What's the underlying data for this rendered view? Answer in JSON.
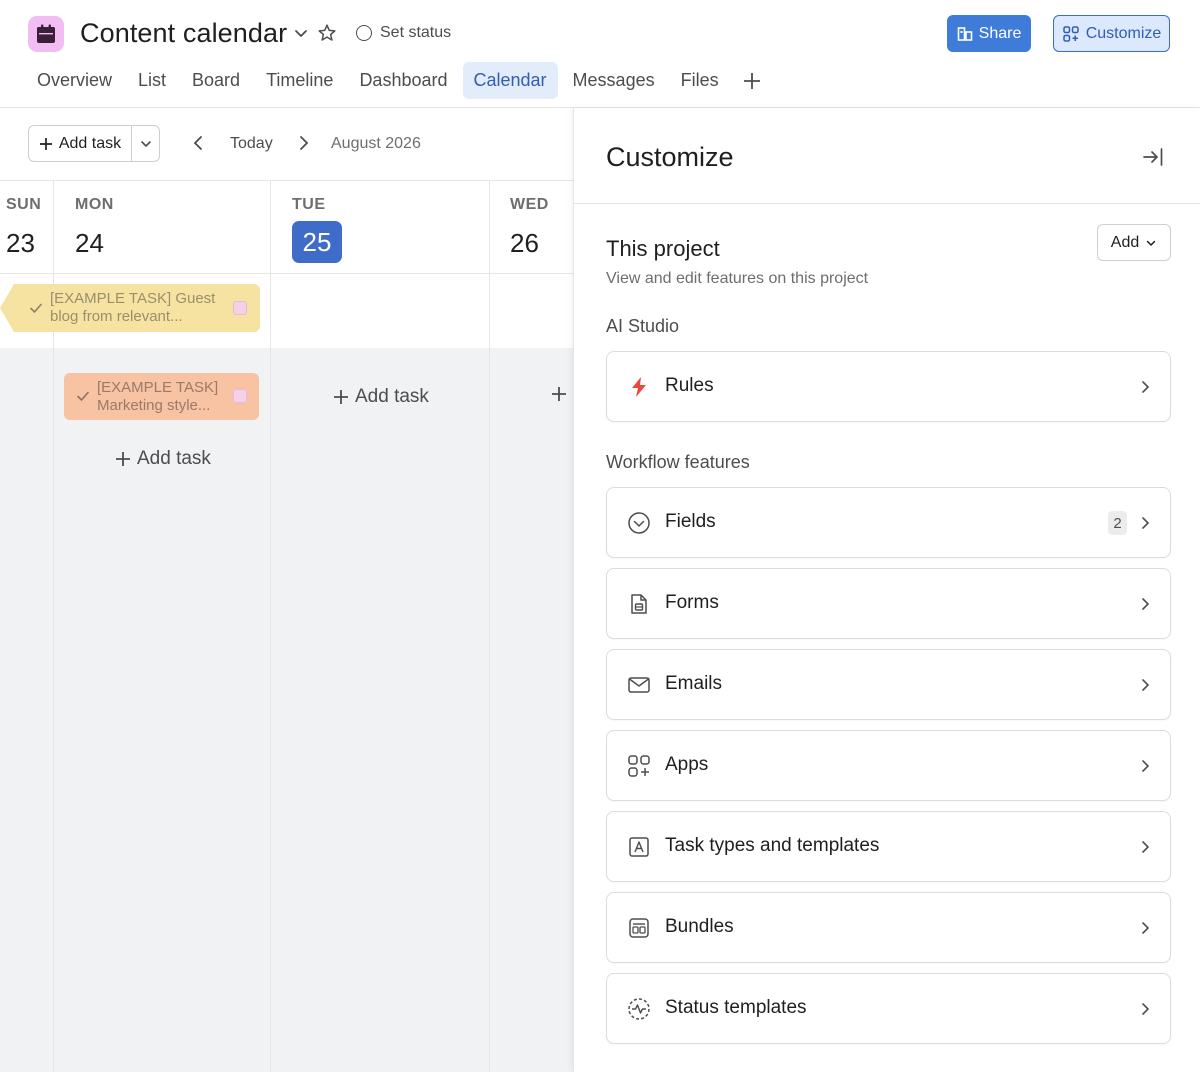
{
  "header": {
    "project_title": "Content calendar",
    "set_status": "Set status",
    "share_label": "Share",
    "customize_label": "Customize",
    "tabs": [
      {
        "label": "Overview"
      },
      {
        "label": "List"
      },
      {
        "label": "Board"
      },
      {
        "label": "Timeline"
      },
      {
        "label": "Dashboard"
      },
      {
        "label": "Calendar",
        "active": true
      },
      {
        "label": "Messages"
      },
      {
        "label": "Files"
      }
    ]
  },
  "calendar": {
    "add_task_label": "Add task",
    "today_label": "Today",
    "month_label": "August 2026",
    "days": [
      {
        "name": "SUN",
        "num": "23"
      },
      {
        "name": "MON",
        "num": "24"
      },
      {
        "name": "TUE",
        "num": "25",
        "today": true
      },
      {
        "name": "WED",
        "num": "26"
      }
    ],
    "tasks": [
      {
        "text": "[EXAMPLE TASK] Guest blog from relevant...",
        "color": "#f6e3a1"
      },
      {
        "text": "[EXAMPLE TASK] Marketing style...",
        "color": "#f7c3a3"
      }
    ],
    "add_task_cell_label": "Add task"
  },
  "customize": {
    "title": "Customize",
    "section_title": "This project",
    "section_sub": "View and edit features on this project",
    "add_label": "Add",
    "ai_studio_label": "AI Studio",
    "workflow_label": "Workflow features",
    "items": {
      "rules": "Rules",
      "fields": "Fields",
      "fields_count": "2",
      "forms": "Forms",
      "emails": "Emails",
      "apps": "Apps",
      "task_types": "Task types and templates",
      "bundles": "Bundles",
      "status_templates": "Status templates"
    }
  },
  "colors": {
    "accent": "#3f7bd8",
    "project_icon_bg": "#f1bdf3",
    "today_badge": "#3f6cc9"
  }
}
